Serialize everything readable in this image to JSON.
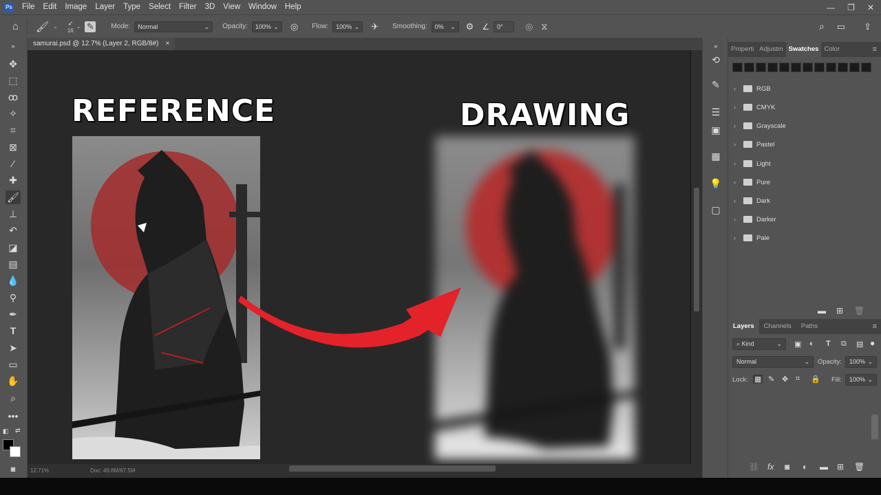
{
  "menubar": {
    "logo": "Ps",
    "items": [
      "File",
      "Edit",
      "Image",
      "Layer",
      "Type",
      "Select",
      "Filter",
      "3D",
      "View",
      "Window",
      "Help"
    ]
  },
  "options": {
    "brush_size": "16",
    "mode_label": "Mode:",
    "mode_value": "Normal",
    "opacity_label": "Opacity:",
    "opacity_value": "100%",
    "flow_label": "Flow:",
    "flow_value": "100%",
    "smoothing_label": "Smoothing:",
    "smoothing_value": "0%",
    "angle_value": "0°"
  },
  "document": {
    "tab_title": "samurai.psd @ 12.7% (Layer 2, RGB/8#)",
    "close": "×",
    "zoom_status": "12.71%",
    "doc_status": "Doc: 49.8M/87.5M"
  },
  "canvas": {
    "reference_title": "REFERENCE",
    "drawing_title": "DRAWING"
  },
  "swatches_panel": {
    "tabs": [
      "Properti",
      "Adjustm",
      "Swatches",
      "Color"
    ],
    "active_tab": "Swatches",
    "folders": [
      "RGB",
      "CMYK",
      "Grayscale",
      "Pastel",
      "Light",
      "Pure",
      "Dark",
      "Darker",
      "Pale"
    ]
  },
  "layers_panel": {
    "tabs": [
      "Layers",
      "Channels",
      "Paths"
    ],
    "active_tab": "Layers",
    "kind_label": "Kind",
    "blend_mode": "Normal",
    "opacity_label": "Opacity:",
    "opacity_value": "100%",
    "lock_label": "Lock:",
    "fill_label": "Fill:",
    "fill_value": "100%"
  },
  "colors": {
    "ui_bg": "#535353",
    "canvas_bg": "#282828",
    "accent_red": "#e3222a"
  }
}
